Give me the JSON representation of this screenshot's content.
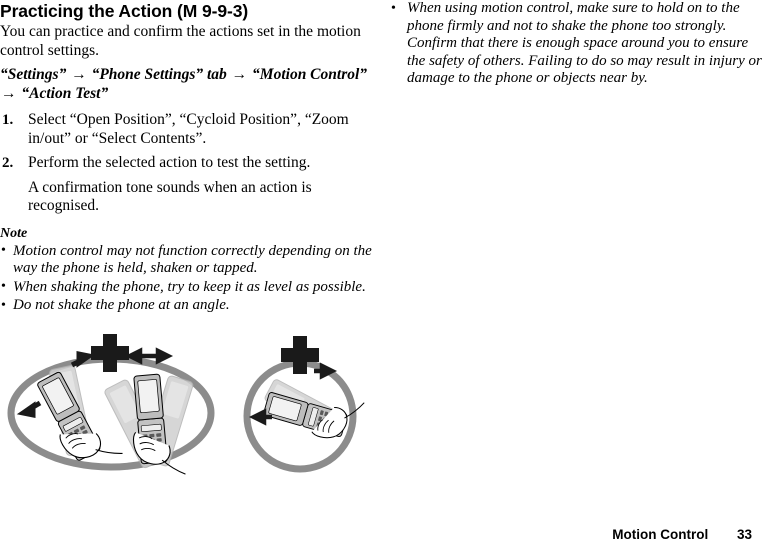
{
  "document": {
    "heading": "Practicing the Action (M 9-9-3)",
    "intro": "You can practice and confirm the actions set in the motion control settings."
  },
  "nav_path": {
    "part1": "“Settings”",
    "arrow1": "→",
    "part2": "“Phone Settings” tab",
    "arrow2": "→",
    "part3": "“Motion Control”",
    "arrow3": "→",
    "part4": "“Action Test”"
  },
  "steps": [
    {
      "number": "1.",
      "text": "Select “Open Position”, “Cycloid Position”, “Zoom in/out” or “Select Contents”."
    },
    {
      "number": "2.",
      "text": "Perform the selected action to test the setting.",
      "sub": "A confirmation tone sounds when an action is recognised."
    }
  ],
  "note": {
    "heading": "Note",
    "bullet_glyph": "•",
    "items": [
      "Motion control may not function correctly depending on the way the phone is held, shaken or tapped.",
      "When shaking the phone, try to keep it as level as possible.",
      "Do not shake the phone at an angle."
    ]
  },
  "warnings": {
    "bullet_glyph": "•",
    "items": [
      "When using motion control, make sure to hold on to the phone firmly and not to shake the phone too strongly. Confirm that there is enough space around you to ensure the safety of others. Failing to do so may result in injury or damage to the phone or objects near by."
    ]
  },
  "figure": {
    "caption_alt": "Two crossed-out illustrations showing incorrect phone shaking positions",
    "colors": {
      "ellipse_stroke": "#8c8c8c",
      "x_mark": "#1a1a1a",
      "phone_body": "#b8b8b8",
      "phone_dark": "#595959",
      "phone_light": "#d8d8d8",
      "ghost": "#cfcfcf",
      "outline": "#000000"
    }
  },
  "footer": {
    "section": "Motion Control",
    "page_number": "33"
  }
}
